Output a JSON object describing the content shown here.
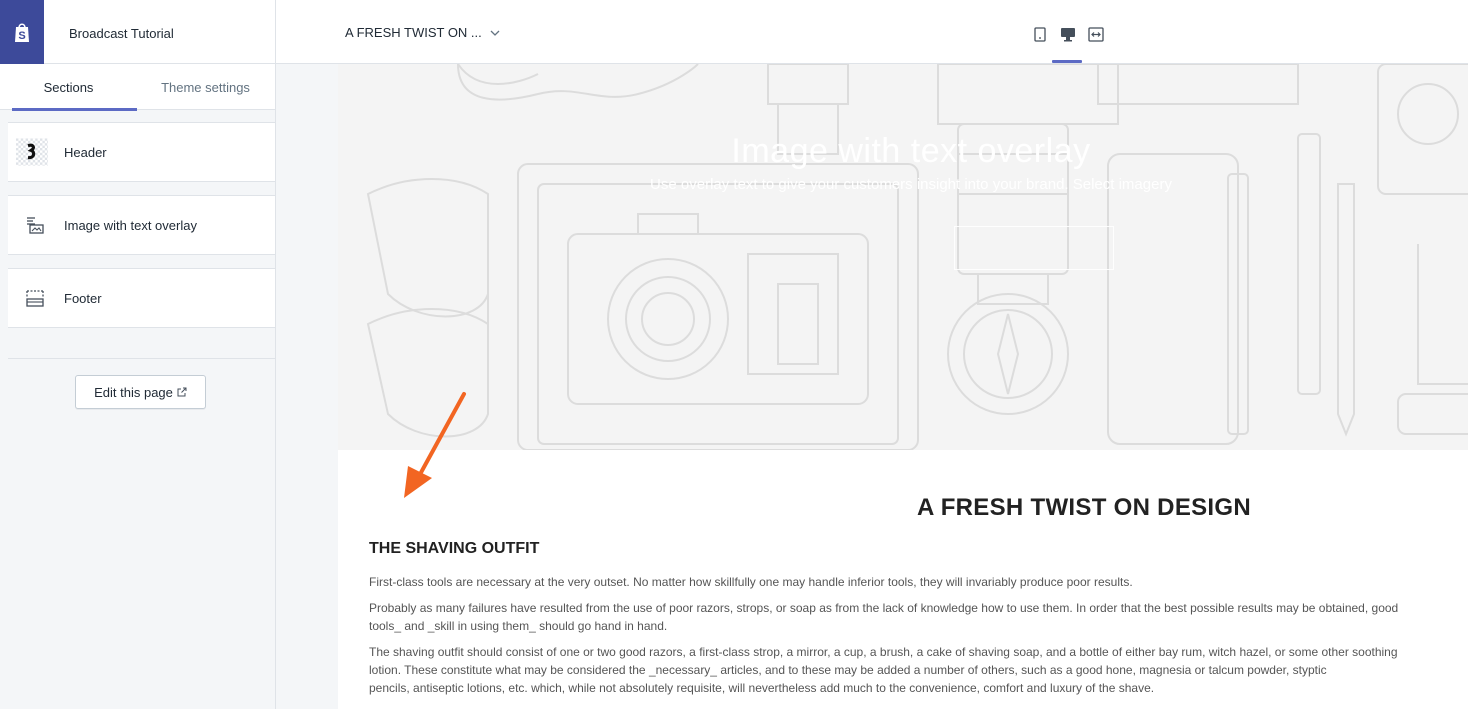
{
  "topbar": {
    "store_name": "Broadcast Tutorial",
    "page_selector": "A FRESH TWIST ON ...",
    "view_icons": [
      "mobile-icon",
      "desktop-icon",
      "fullscreen-icon"
    ]
  },
  "sidebar": {
    "tabs": [
      {
        "label": "Sections",
        "active": true
      },
      {
        "label": "Theme settings",
        "active": false
      }
    ],
    "sections": [
      {
        "label": "Header",
        "icon": "header-thumbnail-icon"
      },
      {
        "label": "Image with text overlay",
        "icon": "image-text-icon"
      },
      {
        "label": "Footer",
        "icon": "footer-icon"
      }
    ],
    "edit_button": "Edit this page"
  },
  "preview": {
    "hero_title": "Image with text overlay",
    "hero_subtitle": "Use overlay text to give your customers insight into your brand. Select imagery",
    "content_title": "A FRESH TWIST ON DESIGN",
    "content_subtitle": "THE SHAVING OUTFIT",
    "paragraphs": [
      "First-class tools are necessary at the very outset. No matter how skillfully one may handle inferior tools, they will invariably produce poor results.",
      "Probably as many failures have resulted from the use of poor razors, strops, or soap as from the lack of knowledge how to use them. In order that the best possible results may be obtained, good",
      "tools_ and _skill in using them_ should go hand in hand.",
      "The shaving outfit should consist of one or two good razors, a first-class strop, a mirror, a cup, a brush, a cake of shaving soap, and a bottle of either bay rum, witch hazel, or some other soothing",
      "lotion. These constitute what may be considered the _necessary_ articles, and to these may be added a number of others, such as a good hone, magnesia or talcum powder, styptic",
      "pencils, antiseptic lotions, etc. which, while not absolutely requisite, will nevertheless add much to the convenience, comfort and luxury of the shave."
    ]
  },
  "colors": {
    "accent": "#5c6ac4",
    "logo_bg": "#3d4a9a",
    "arrow": "#f26522"
  }
}
